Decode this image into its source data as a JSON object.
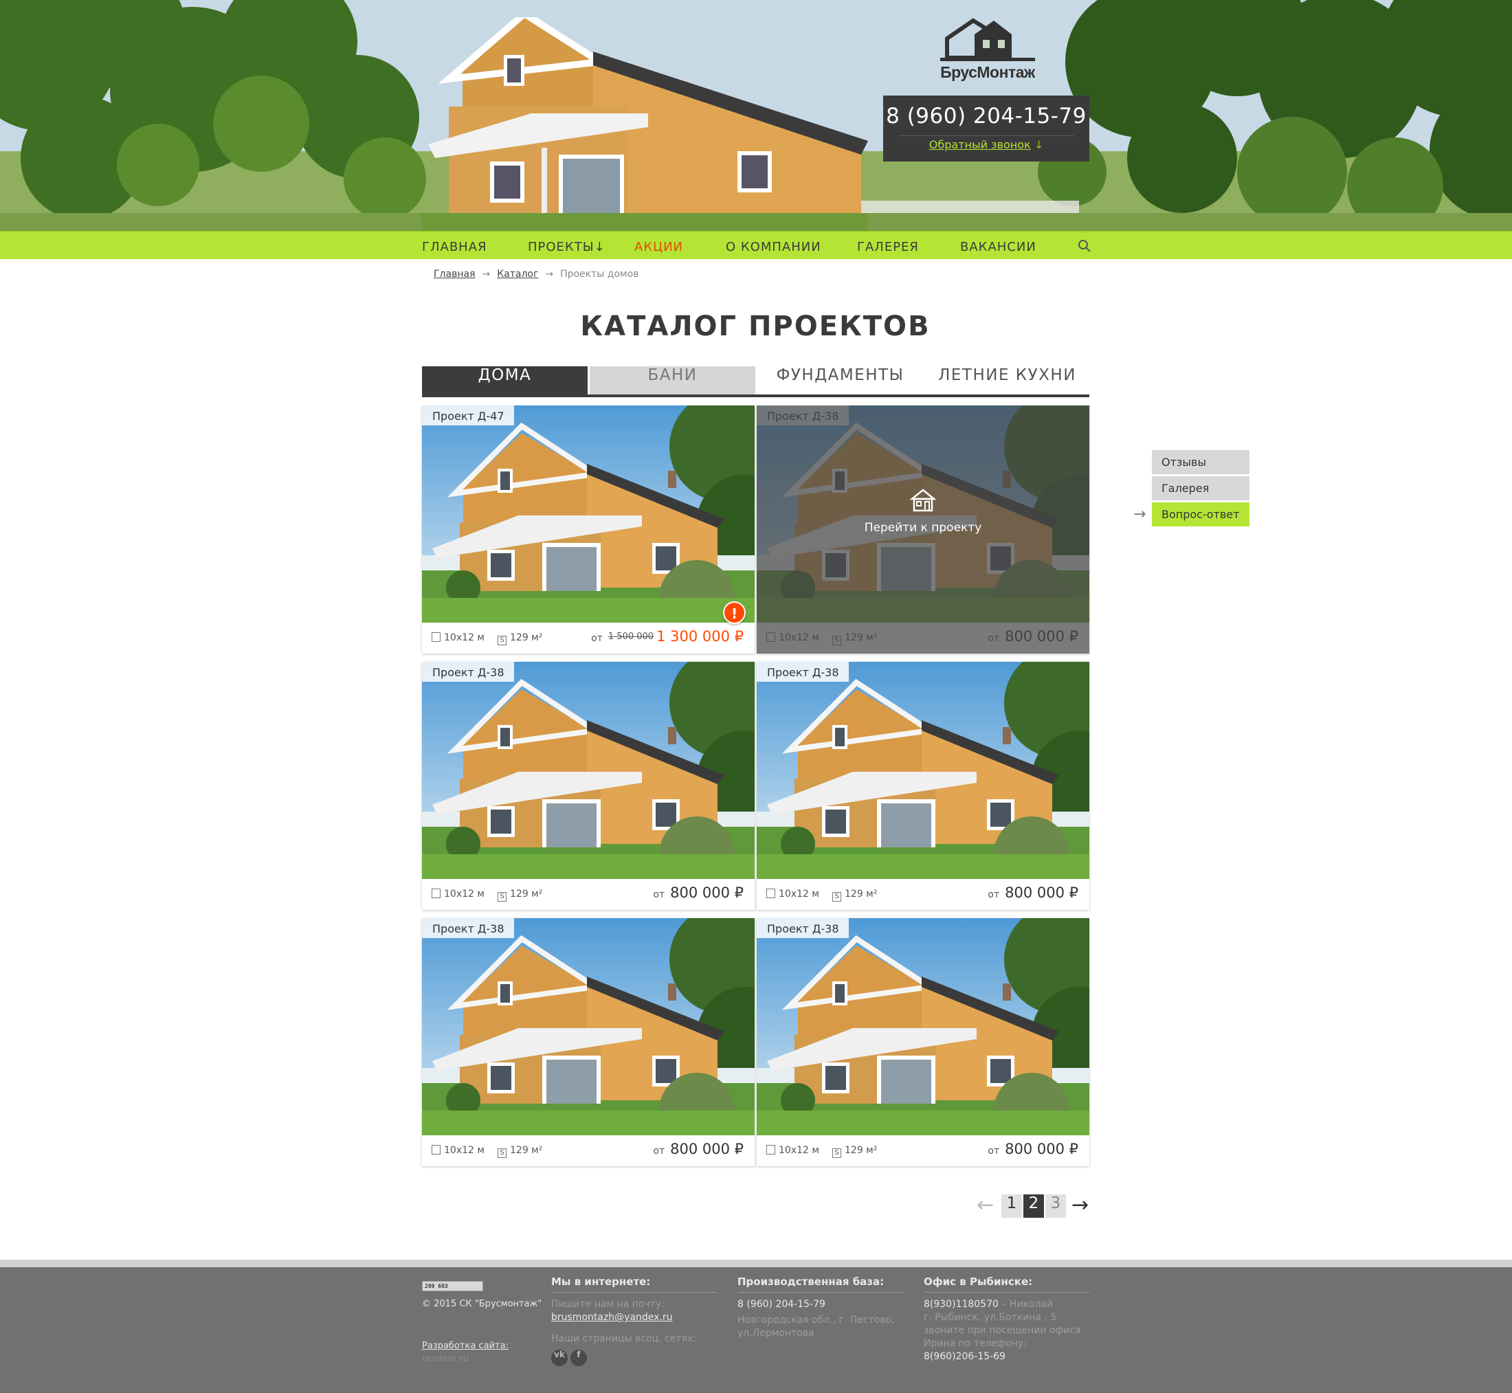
{
  "logo": {
    "text": "БрусМонтаж"
  },
  "contact": {
    "phone": "8 (960) 204-15-79",
    "callback": "Обратный звонок",
    "callback_arrow": "↓"
  },
  "nav": [
    {
      "label": "Главная"
    },
    {
      "label": "Проекты↓"
    },
    {
      "label": "Акции"
    },
    {
      "label": "О компании"
    },
    {
      "label": "Галерея"
    },
    {
      "label": "Вакансии"
    }
  ],
  "breadcrumb": {
    "home": "Главная",
    "catalog": "Каталог",
    "current": "Проекты домов",
    "sep": "→"
  },
  "page_title": "КАТАЛОГ ПРОЕКТОВ",
  "tabs": [
    {
      "label": "ДОМА"
    },
    {
      "label": "БАНИ"
    },
    {
      "label": "ФУНДАМЕНТЫ"
    },
    {
      "label": "ЛЕТНИЕ КУХНИ"
    }
  ],
  "cards": [
    {
      "name": "Проект Д-47",
      "size": "10x12 м",
      "area": "129 м²",
      "price_prefix": "от",
      "old_price": "1 500 000",
      "price": "1 300 000 ₽",
      "badge": "!"
    },
    {
      "name": "Проект Д-38",
      "size": "10x12 м",
      "area": "129 м²",
      "price_prefix": "от",
      "price": "800 000 ₽",
      "overlay_text": "Перейти к проекту"
    },
    {
      "name": "Проект Д-38",
      "size": "10x12 м",
      "area": "129 м²",
      "price_prefix": "от",
      "price": "800 000 ₽"
    },
    {
      "name": "Проект Д-38",
      "size": "10x12 м",
      "area": "129 м²",
      "price_prefix": "от",
      "price": "800 000 ₽"
    },
    {
      "name": "Проект Д-38",
      "size": "10x12 м",
      "area": "129 м²",
      "price_prefix": "от",
      "price": "800 000 ₽"
    },
    {
      "name": "Проект Д-38",
      "size": "10x12 м",
      "area": "129 м²",
      "price_prefix": "от",
      "price": "800 000 ₽"
    }
  ],
  "side_menu": [
    {
      "label": "Отзывы"
    },
    {
      "label": "Галерея"
    },
    {
      "label": "Вопрос-ответ"
    }
  ],
  "pagination": {
    "prev": "←",
    "pages": [
      "1",
      "2",
      "3"
    ],
    "current": "2",
    "next": "→"
  },
  "footer": {
    "counter": "209 683",
    "copyright": "© 2015 СК \"Брусмонтаж\"",
    "developer_label": "Разработка сайта:",
    "developer_name": "tandem.ru",
    "online": {
      "title": "Мы в интернете:",
      "mail_label": "Пишите нам на почту:",
      "email": "brusmontazh@yandex.ru",
      "social_label": "Наши страницы всоц. сетях:",
      "social": [
        "vk",
        "f"
      ]
    },
    "production": {
      "title": "Производственная база:",
      "phone": "8 (960) 204-15-79",
      "address_1": "Новгородская обл., г. Пестово,",
      "address_2": "ул.Лермонтова"
    },
    "office": {
      "title": "Офис в Рыбинске:",
      "phone_1": "8(930)1180570",
      "person": " – Николай",
      "address": "г. Рыбинск, ул.Боткина , 5",
      "note_1": "звоните при посещении офиса",
      "note_2": "Ирина по телефону:",
      "phone_2": "8(960)206-15-69"
    }
  },
  "colors": {
    "accent": "#b4e535",
    "dark": "#3c3c3c",
    "sale": "#ff4a00",
    "footer": "#717171"
  }
}
